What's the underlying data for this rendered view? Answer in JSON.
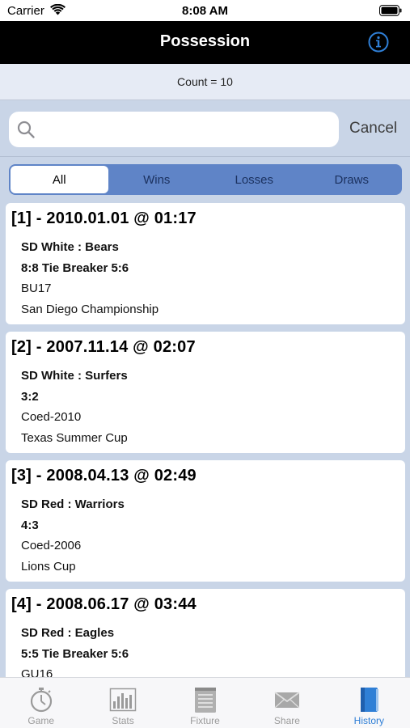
{
  "status_bar": {
    "carrier": "Carrier",
    "time": "8:08 AM"
  },
  "nav": {
    "title": "Possession",
    "info_icon": "info-circle-icon"
  },
  "count_text": "Count = 10",
  "search": {
    "placeholder": "",
    "value": "",
    "cancel_label": "Cancel"
  },
  "segments": [
    {
      "label": "All",
      "active": true
    },
    {
      "label": "Wins",
      "active": false
    },
    {
      "label": "Losses",
      "active": false
    },
    {
      "label": "Draws",
      "active": false
    }
  ],
  "games": [
    {
      "title": "[1] - 2010.01.01 @ 01:17",
      "teams": "SD White : Bears",
      "score": "8:8  Tie Breaker 5:6",
      "division": "BU17",
      "tournament": "San Diego Championship"
    },
    {
      "title": "[2] - 2007.11.14 @ 02:07",
      "teams": "SD White : Surfers",
      "score": "3:2",
      "division": "Coed-2010",
      "tournament": "Texas Summer Cup"
    },
    {
      "title": "[3] - 2008.04.13 @ 02:49",
      "teams": "SD Red : Warriors",
      "score": "4:3",
      "division": "Coed-2006",
      "tournament": "Lions Cup"
    },
    {
      "title": "[4] - 2008.06.17 @ 03:44",
      "teams": "SD Red : Eagles",
      "score": "5:5  Tie Breaker 5:6",
      "division": "GU16",
      "tournament": ""
    }
  ],
  "tabs": [
    {
      "label": "Game",
      "icon": "stopwatch-icon",
      "active": false
    },
    {
      "label": "Stats",
      "icon": "bar-chart-icon",
      "active": false
    },
    {
      "label": "Fixture",
      "icon": "notepad-icon",
      "active": false
    },
    {
      "label": "Share",
      "icon": "envelope-icon",
      "active": false
    },
    {
      "label": "History",
      "icon": "book-icon",
      "active": true
    }
  ],
  "colors": {
    "accent": "#2f7fd6",
    "nav_background": "#000000",
    "segment_background": "#5f84c7",
    "list_background": "#c9d5e7"
  }
}
